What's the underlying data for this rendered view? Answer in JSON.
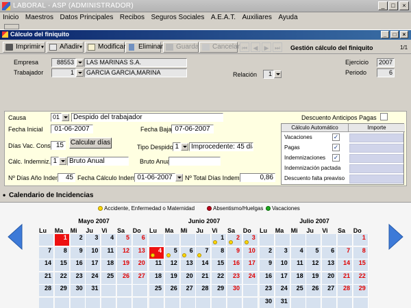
{
  "window": {
    "title": "LABORAL - ASP (ADMINISTRADOR)"
  },
  "menu": [
    "Inicio",
    "Maestros",
    "Datos Principales",
    "Recibos",
    "Seguros Sociales",
    "A.E.A.T.",
    "Auxiliares",
    "Ayuda"
  ],
  "child": {
    "title": "Cálculo del finiquito"
  },
  "toolbar": {
    "imprimir": "Imprimir",
    "anadir": "Añadir",
    "modificar": "Modificar",
    "eliminar": "Eliminar",
    "guardar": "Guardar",
    "cancelar": "Cancelar",
    "section_title": "Gestión cálculo del finiquito",
    "pager": "1/1"
  },
  "header": {
    "empresa_label": "Empresa",
    "empresa_code": "88553",
    "empresa_name": "LAS MARINAS S.A.",
    "trabajador_label": "Trabajador",
    "trabajador_code": "1",
    "trabajador_name": "GARCIA GARCIA,MARINA",
    "relacion_label": "Relación",
    "relacion_value": "1",
    "ejercicio_label": "Ejercicio",
    "ejercicio_value": "2007",
    "periodo_label": "Periodo",
    "periodo_value": "6"
  },
  "form": {
    "causa_label": "Causa",
    "causa_code": "01",
    "causa_text": "Despido del trabajador",
    "desc_anticipos_label": "Descuento Anticipos Pagas",
    "fecha_inicial_label": "Fecha Inicial",
    "fecha_inicial": "01-06-2007",
    "fecha_baja_label": "Fecha Baja",
    "fecha_baja": "07-06-2007",
    "dias_vac_label": "Días Vac. Cons.",
    "dias_vac": "15",
    "calcular_label": "Calcular días",
    "tipo_despido_label": "Tipo Despido",
    "tipo_despido_code": "1",
    "tipo_despido_text": "Improcedente: 45 días",
    "calc_indemn_label": "Cálc. Indemniz.",
    "calc_indemn_code": "1",
    "calc_indemn_text": "Bruto Anual",
    "bruto_anual_label": "Bruto Anual",
    "bruto_anual": "",
    "dias_ano_label": "Nº Días Año Indem.",
    "dias_ano": "45",
    "fecha_calc_label": "Fecha Cálculo Indem.",
    "fecha_calc": "01-06-2007",
    "total_dias_label": "Nº Total Días Indemn.",
    "total_dias": "0,86"
  },
  "calculo": {
    "header_left": "Cálculo Automático",
    "header_right": "Importe",
    "rows": [
      {
        "label": "Vacaciones",
        "checked": "✓"
      },
      {
        "label": "Pagas",
        "checked": "✓"
      },
      {
        "label": "Indemnizaciones",
        "checked": "✓"
      },
      {
        "label": "Indemnización pactada",
        "checked": ""
      },
      {
        "label": "Descuento falta preaviso",
        "checked": ""
      }
    ]
  },
  "calendar": {
    "section_title": "Calendario de Incidencias",
    "legend": [
      {
        "label": "Accidente, Enfermedad o Maternidad",
        "color": "#ffd800"
      },
      {
        "label": "Absentismo/Huelgas",
        "color": "#c00020"
      },
      {
        "label": "Vacaciones",
        "color": "#22aa22"
      }
    ],
    "weekdays": [
      "Lu",
      "Ma",
      "Mi",
      "Ju",
      "Vi",
      "Sa",
      "Do"
    ],
    "months": [
      {
        "title": "Mayo 2007",
        "offset": 1,
        "days": 31,
        "selected": [
          1
        ],
        "events": []
      },
      {
        "title": "Junio 2007",
        "offset": 4,
        "days": 30,
        "selected": [
          4
        ],
        "events": [
          1,
          2,
          3,
          4,
          5,
          6,
          7
        ]
      },
      {
        "title": "Julio 2007",
        "offset": 6,
        "days": 31,
        "selected": [],
        "events": []
      }
    ]
  }
}
